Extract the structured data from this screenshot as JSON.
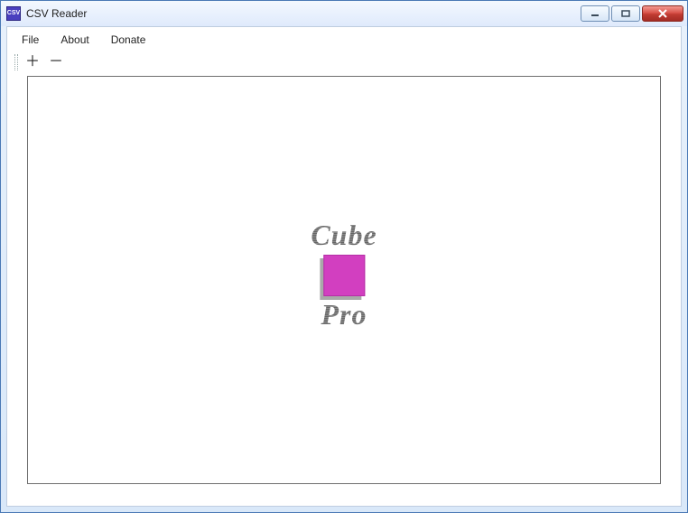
{
  "window": {
    "title": "CSV Reader",
    "appicon_text": "CSV"
  },
  "menubar": {
    "items": [
      {
        "label": "File"
      },
      {
        "label": "About"
      },
      {
        "label": "Donate"
      }
    ]
  },
  "toolbar": {
    "buttons": [
      {
        "name": "plus-icon",
        "glyph": "＋"
      },
      {
        "name": "minus-icon",
        "glyph": "－"
      }
    ]
  },
  "logo": {
    "line1": "Cube",
    "line2": "Pro"
  }
}
